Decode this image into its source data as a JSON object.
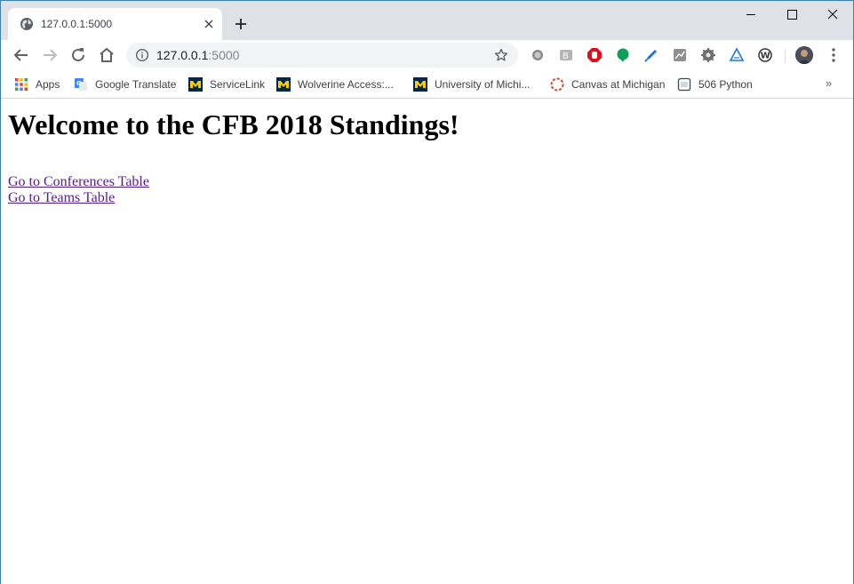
{
  "browser": {
    "tab": {
      "title": "127.0.0.1:5000"
    },
    "address": {
      "host": "127.0.0.1",
      "port": ":5000"
    },
    "bookmarks": [
      {
        "label": "Apps",
        "icon": "apps-grid-icon"
      },
      {
        "label": "Google Translate",
        "icon": "google-translate-icon"
      },
      {
        "label": "ServiceLink",
        "icon": "michigan-block-m-icon"
      },
      {
        "label": "Wolverine Access:...",
        "icon": "michigan-block-m-icon"
      },
      {
        "label": "University of Michi...",
        "icon": "michigan-block-m-icon"
      },
      {
        "label": "Canvas at Michigan",
        "icon": "canvas-icon"
      },
      {
        "label": "506 Python",
        "icon": "python-book-icon"
      }
    ],
    "bookmarks_overflow": "»",
    "colors": {
      "tabstrip": "#dee1e6",
      "omnibox": "#f1f3f4",
      "visited_link": "#551a8b",
      "michigan_blue": "#00274c",
      "michigan_maize": "#ffcb05"
    }
  },
  "page": {
    "heading": "Welcome to the CFB 2018 Standings!",
    "links": [
      {
        "label": "Go to Conferences Table"
      },
      {
        "label": "Go to Teams Table"
      }
    ]
  }
}
